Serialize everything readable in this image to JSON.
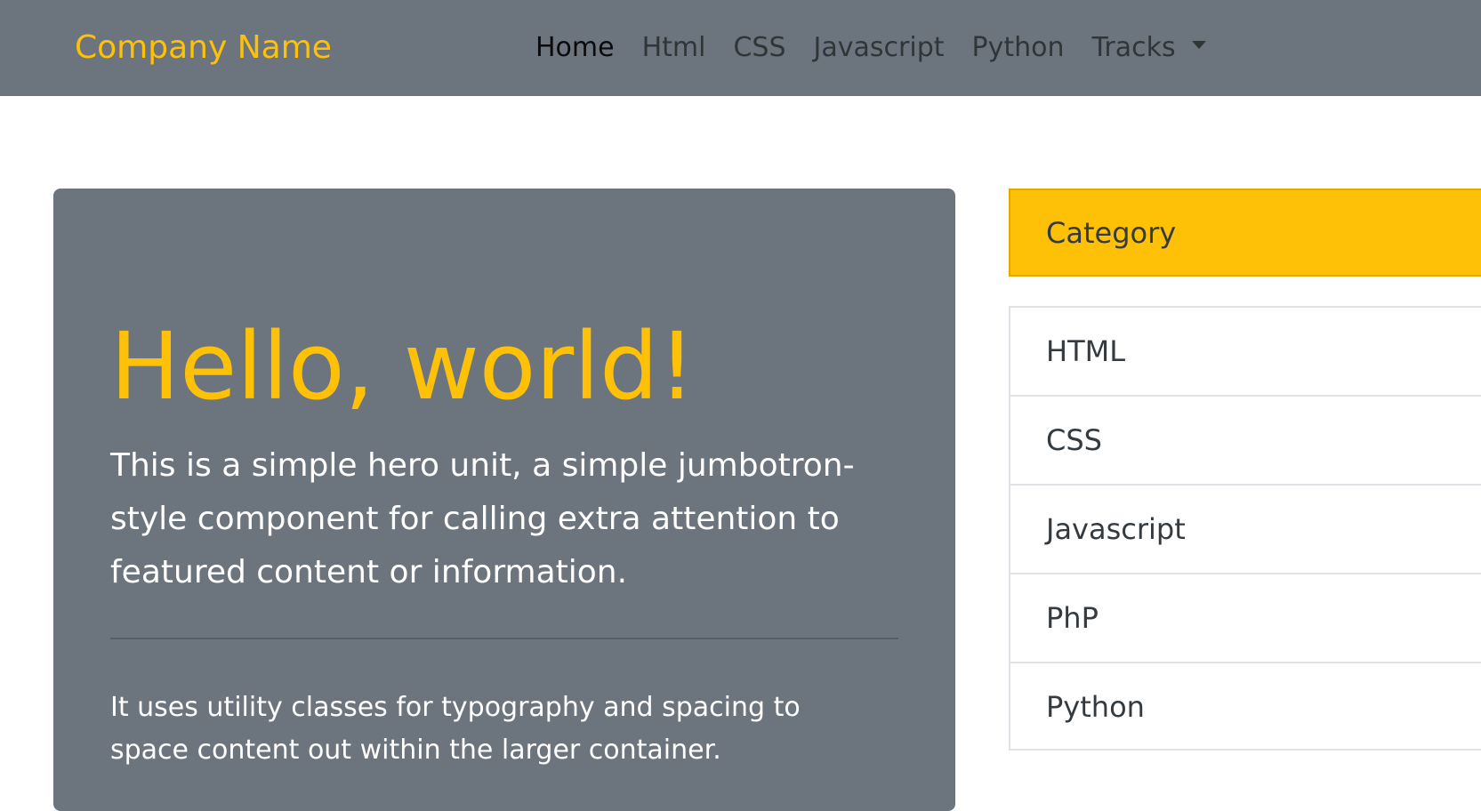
{
  "navbar": {
    "brand": "Company Name",
    "items": [
      {
        "label": "Home",
        "active": true
      },
      {
        "label": "Html",
        "active": false
      },
      {
        "label": "CSS",
        "active": false
      },
      {
        "label": "Javascript",
        "active": false
      },
      {
        "label": "Python",
        "active": false
      },
      {
        "label": "Tracks",
        "active": false,
        "dropdown": true
      }
    ]
  },
  "hero": {
    "title": "Hello, world!",
    "lead": "This is a simple hero unit, a simple jumbotron-style component for calling extra attention to featured content or information.",
    "text": "It uses utility classes for typography and spacing to space content out within the larger container."
  },
  "sidebar": {
    "header": "Category",
    "items": [
      "HTML",
      "CSS",
      "Javascript",
      "PhP",
      "Python"
    ]
  },
  "colors": {
    "navbar_bg": "#6c757d",
    "accent": "#ffc107",
    "hero_bg": "#6c757d"
  },
  "icons": {
    "dropdown": "caret-down-icon"
  }
}
